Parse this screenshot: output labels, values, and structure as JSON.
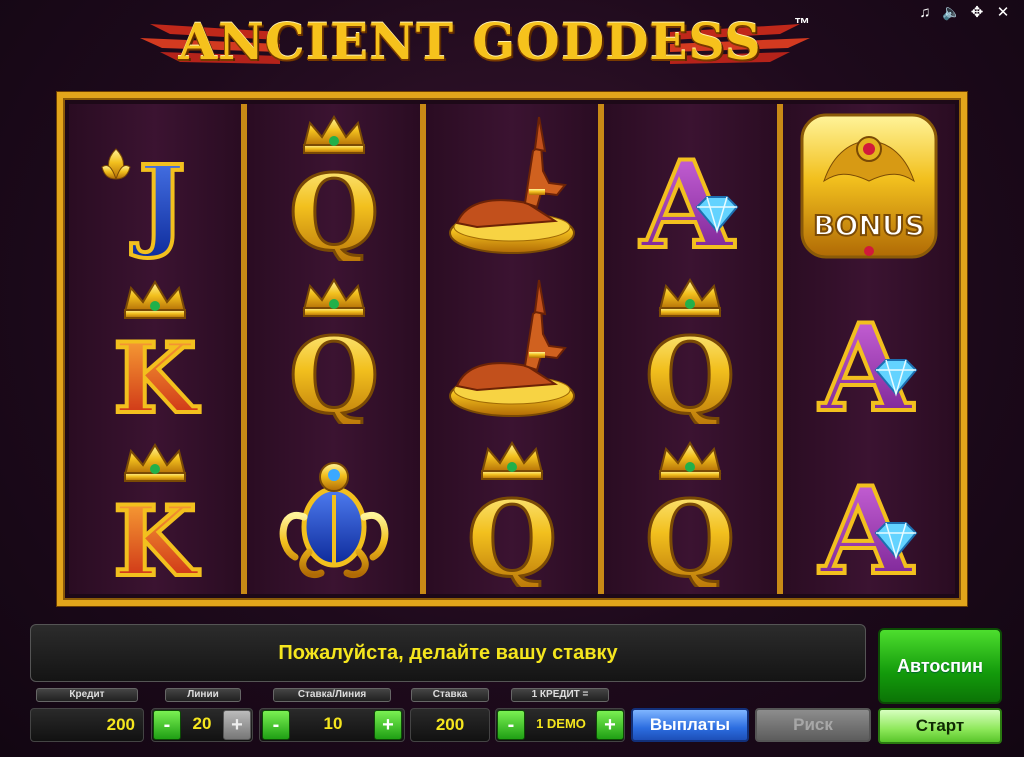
{
  "title": "ANCIENT GODDESS",
  "trademark": "™",
  "top_icons": [
    "music-icon",
    "sound-icon",
    "fullscreen-icon",
    "close-icon"
  ],
  "top_icon_glyphs": [
    "♫",
    "🔈",
    "✥",
    "✕"
  ],
  "reels": [
    [
      "J",
      "K",
      "K"
    ],
    [
      "Q",
      "Q",
      "scarab"
    ],
    [
      "anubis",
      "anubis",
      "Q"
    ],
    [
      "A",
      "Q",
      "Q"
    ],
    [
      "bonus",
      "A",
      "A"
    ]
  ],
  "bonus_text": "BONUS",
  "message": "Пожалуйста, делайте вашу ставку",
  "labels": {
    "credit": "Кредит",
    "lines": "Линии",
    "bet_per_line": "Ставка/Линия",
    "bet": "Ставка",
    "one_credit": "1 КРЕДИТ ="
  },
  "values": {
    "credit": "200",
    "lines": "20",
    "bet_per_line": "10",
    "bet": "200",
    "denomination": "1 DEMO"
  },
  "buttons": {
    "minus": "-",
    "plus": "+",
    "autospin": "Автоспин",
    "start": "Старт",
    "payouts": "Выплаты",
    "risk": "Риск"
  },
  "colors": {
    "frame_gold": "#e2a51b",
    "message_yellow": "#f5e61e",
    "green_button": "#139a0b",
    "blue_button": "#2c6de0"
  }
}
